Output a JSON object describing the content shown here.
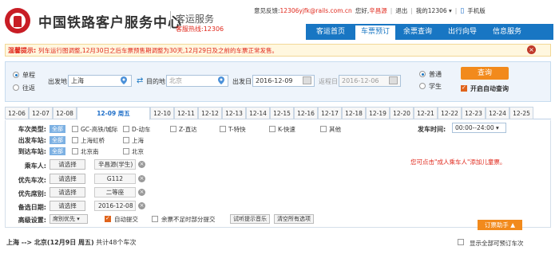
{
  "header": {
    "site_title": "中国铁路客户服务中心",
    "brand_name": "客运服务",
    "hotline": "客服热线:12306"
  },
  "topbar": {
    "feedback_label": "意见反馈:",
    "feedback_email": "12306yjfk@rails.com.cn",
    "greeting": "您好,",
    "user_name": "辛昌源",
    "logout": "退出",
    "my12306": "我的12306 ▾",
    "mobile": "手机版"
  },
  "nav": {
    "items": [
      "客运首页",
      "车票预订",
      "余票查询",
      "出行向导",
      "信息服务"
    ],
    "active_index": 1
  },
  "notice": {
    "label": "温馨提示:",
    "text": "列车运行图调整,12月30日之后车票预售期调整为30天,12月29日及之前的车票正常发售。",
    "close_icon": "close-icon"
  },
  "search": {
    "trip_type_oneway": "单程",
    "trip_type_round": "往返",
    "from_label": "出发地",
    "from_value": "上海",
    "to_label": "目的地",
    "to_value": "北京",
    "depart_label": "出发日",
    "depart_value": "2016-12-09",
    "return_label": "返程日",
    "return_value": "2016-12-06",
    "ticket_normal": "普通",
    "ticket_student": "学生",
    "query_button": "查询",
    "auto_query": "开启自动查询"
  },
  "date_tabs": [
    "12-06",
    "12-07",
    "12-08",
    "12-09 周五",
    "12-10",
    "12-11",
    "12-12",
    "12-13",
    "12-14",
    "12-15",
    "12-16",
    "12-17",
    "12-18",
    "12-19",
    "12-20",
    "12-21",
    "12-22",
    "12-23",
    "12-24",
    "12-25"
  ],
  "date_active_index": 3,
  "filter": {
    "train_type_label": "车次类型:",
    "all_label": "全部",
    "train_types": [
      "GC-高铁/城际",
      "D-动车",
      "Z-直达",
      "T-特快",
      "K-快速",
      "其他"
    ],
    "depart_time_label": "发车时间:",
    "depart_time_value": "00:00--24:00 ▾",
    "from_station_label": "出发车站:",
    "from_stations": [
      "上海虹桥",
      "上海"
    ],
    "to_station_label": "到达车站:",
    "to_stations": [
      "北京南",
      "北京"
    ],
    "passenger_label": "乘车人:",
    "passenger_select": "请选择",
    "passenger_tag": "辛昌源(学生)",
    "priority_train_label": "优先车次:",
    "priority_train_select": "请选择",
    "priority_train_tag": "G112",
    "priority_seat_label": "优先席别:",
    "priority_seat_select": "请选择",
    "priority_seat_tag": "二等座",
    "backup_date_label": "备选日期:",
    "backup_date_select": "请选择",
    "backup_date_tag": "2016-12-08",
    "advanced_label": "高级设置:",
    "priority_mode": "席别优先 ▾",
    "auto_submit": "自动提交",
    "partial_submit": "余票不足时部分提交",
    "music_button": "试听提示音乐",
    "clear_button": "清空所有选项",
    "tips": "您可点击\"成人乘车人\"添加儿童票。",
    "assist_button": "订票助手 ▲"
  },
  "result": {
    "route": "上海 --> 北京(12月9日 周五)",
    "count_text": "共计48个车次",
    "show_all": "显示全部可预订车次"
  },
  "colors": {
    "brand_red": "#c81d25",
    "nav_blue": "#1876c3",
    "accent_orange": "#f28a1c"
  }
}
